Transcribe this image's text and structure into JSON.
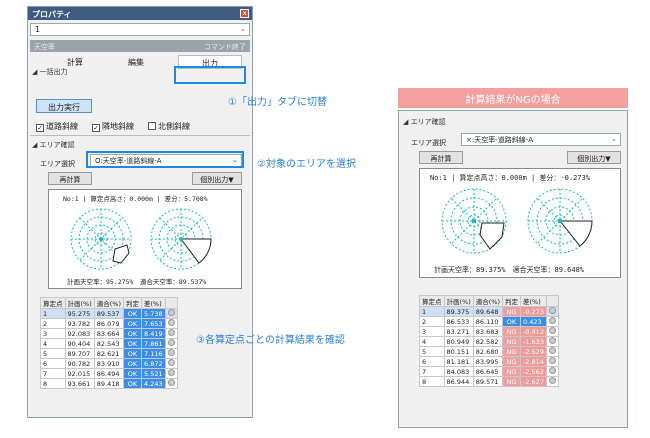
{
  "left": {
    "title": "プロパティ",
    "close": "x",
    "combo": "1",
    "gray_left": "天空率",
    "gray_right": "コマンド終了",
    "tabs": [
      "計算",
      "編集",
      "出力"
    ],
    "sec_batch": "◢ 一括出力",
    "run_button": "出力実行",
    "checks": [
      "道路斜線",
      "隣地斜線",
      "北側斜線"
    ],
    "checked": [
      true,
      true,
      false
    ],
    "sec_area": "◢ エリア確認",
    "area_label": "エリア選択",
    "area_value": "O:天空率-道路斜線-A",
    "recalc": "再計算",
    "indiv": "個別出力▼",
    "chart_header": "No:1 | 算定点高さ：0.000m | 差分：5.708%",
    "chart_footer": "計画天空率：95.275%　適合天空率：89.537%",
    "cols": [
      "算定点",
      "計画(%)",
      "適合(%)",
      "判定",
      "差(%)"
    ],
    "rows": [
      [
        "1",
        "95.275",
        "89.537",
        "OK",
        "5.738"
      ],
      [
        "2",
        "93.782",
        "86.079",
        "OK",
        "7.653"
      ],
      [
        "3",
        "92.083",
        "83.664",
        "OK",
        "8.419"
      ],
      [
        "4",
        "90.404",
        "82.543",
        "OK",
        "7.861"
      ],
      [
        "5",
        "89.707",
        "82.621",
        "OK",
        "7.116"
      ],
      [
        "6",
        "90.782",
        "83.910",
        "OK",
        "6.872"
      ],
      [
        "7",
        "92.015",
        "86.494",
        "OK",
        "5.521"
      ],
      [
        "8",
        "93.661",
        "89.418",
        "OK",
        "4.243"
      ]
    ]
  },
  "annotations": {
    "a1": "①「出力」タブに切替",
    "a2": "②対象のエリアを選択",
    "a3": "③各算定点ごとの計算結果を確認"
  },
  "right": {
    "banner": "計算結果がNGの場合",
    "sec_area": "◢ エリア確認",
    "area_label": "エリア選択",
    "area_value": "×:天空率-道路斜線-A",
    "recalc": "再計算",
    "indiv": "個別出力▼",
    "chart_header": "No:1 | 算定点高さ：0.000m | 差分：-0.273%",
    "chart_footer": "計画天空率：89.375%　適合天空率：89.648%",
    "cols": [
      "算定点",
      "計画(%)",
      "適合(%)",
      "判定",
      "差(%)"
    ],
    "rows": [
      [
        "1",
        "89.375",
        "89.648",
        "NG",
        "-0.273"
      ],
      [
        "2",
        "86.533",
        "86.110",
        "OK",
        "0.423"
      ],
      [
        "3",
        "83.271",
        "83.683",
        "NG",
        "-0.412"
      ],
      [
        "4",
        "80.949",
        "82.582",
        "NG",
        "-1.633"
      ],
      [
        "5",
        "80.151",
        "82.680",
        "NG",
        "-2.529"
      ],
      [
        "6",
        "81.181",
        "83.995",
        "NG",
        "-2.814"
      ],
      [
        "7",
        "84.083",
        "86.645",
        "NG",
        "-2.562"
      ],
      [
        "8",
        "86.944",
        "89.571",
        "NG",
        "-2.627"
      ]
    ]
  },
  "colors": {
    "ok": "#3c8ee8",
    "ng": "#f0a0a0",
    "accent": "#1e88e5",
    "title_bar": "#3f5b80",
    "banner": "#f5a0a0"
  }
}
